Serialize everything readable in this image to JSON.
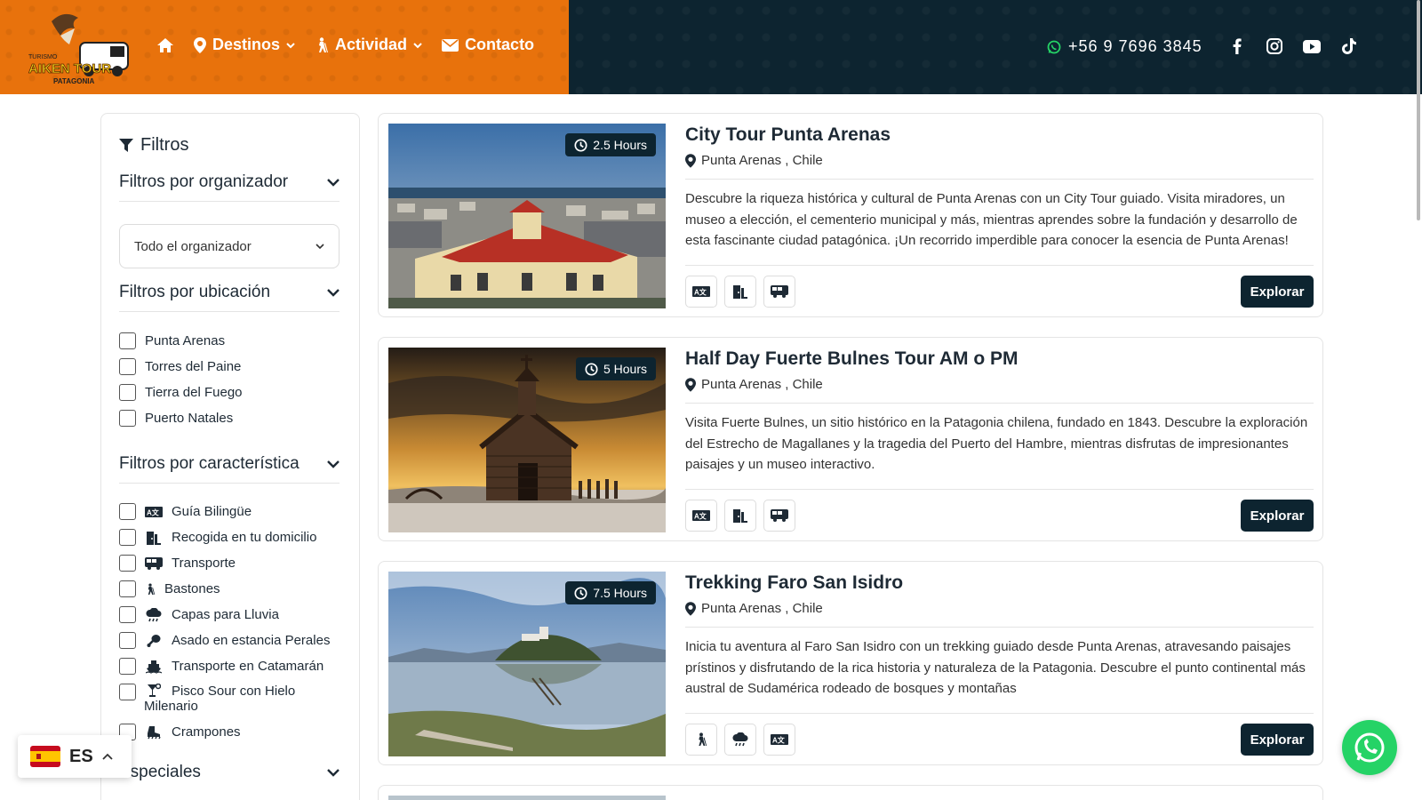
{
  "header": {
    "logo_text": [
      "TURISMO",
      "AIKEN TOUR",
      "PATAGONIA"
    ],
    "nav": [
      {
        "label": "Destinos",
        "icon": "map-pin-icon",
        "dropdown": true
      },
      {
        "label": "Actividad",
        "icon": "hiker-icon",
        "dropdown": true
      },
      {
        "label": "Contacto",
        "icon": "envelope-icon",
        "dropdown": false
      }
    ],
    "phone": "+56 9 7696 3845",
    "socials": [
      "facebook-icon",
      "instagram-icon",
      "youtube-icon",
      "tiktok-icon"
    ],
    "colors": {
      "orange": "#e8720c",
      "navy": "#0d2430"
    }
  },
  "sidebar": {
    "title": "Filtros",
    "organizer_section": "Filtros por organizador",
    "organizer_select": "Todo el organizador",
    "location_section": "Filtros por ubicación",
    "locations": [
      "Punta Arenas",
      "Torres del Paine",
      "Tierra del Fuego",
      "Puerto Natales"
    ],
    "feature_section": "Filtros por característica",
    "features": [
      {
        "label": "Guía Bilingüe",
        "icon": "translate-icon"
      },
      {
        "label": "Recogida en tu domicilio",
        "icon": "door-icon"
      },
      {
        "label": "Transporte",
        "icon": "bus-icon"
      },
      {
        "label": "Bastones",
        "icon": "hiker-icon"
      },
      {
        "label": "Capas para Lluvia",
        "icon": "rain-cloud-icon"
      },
      {
        "label": "Asado en estancia Perales",
        "icon": "drumstick-icon"
      },
      {
        "label": "Transporte en Catamarán",
        "icon": "ship-icon"
      },
      {
        "label": "Pisco Sour con Hielo",
        "label2": "Milenario",
        "icon": "cocktail-icon"
      },
      {
        "label": "Crampones",
        "icon": "boot-icon"
      }
    ],
    "special_section": "Especiales"
  },
  "tours": [
    {
      "title": "City Tour Punta Arenas",
      "duration": "2.5 Hours",
      "location": "Punta Arenas , Chile",
      "description": "Descubre la riqueza histórica y cultural de Punta Arenas con un City Tour guiado. Visita miradores, un museo a elección, el cementerio municipal y más, mientras aprendes sobre la fundación y desarrollo de esta fascinante ciudad patagónica. ¡Un recorrido imperdible para conocer la esencia de Punta Arenas!",
      "features": [
        "translate-icon",
        "door-icon",
        "bus-icon"
      ],
      "button": "Explorar"
    },
    {
      "title": "Half Day Fuerte Bulnes Tour AM o PM",
      "duration": "5 Hours",
      "location": "Punta Arenas , Chile",
      "description": "Visita Fuerte Bulnes, un sitio histórico en la Patagonia chilena, fundado en 1843. Descubre la exploración del Estrecho de Magallanes y la tragedia del Puerto del Hambre, mientras disfrutas de impresionantes paisajes y un museo interactivo.",
      "features": [
        "translate-icon",
        "door-icon",
        "bus-icon"
      ],
      "button": "Explorar"
    },
    {
      "title": "Trekking Faro San Isidro",
      "duration": "7.5 Hours",
      "location": "Punta Arenas , Chile",
      "description": "Inicia tu aventura al Faro San Isidro con un trekking guiado desde Punta Arenas, atravesando paisajes prístinos y disfrutando de la rica historia y naturaleza de la Patagonia. Descubre el punto continental más austral de Sudamérica rodeado de bosques y montañas",
      "features": [
        "hiker-icon",
        "rain-cloud-icon",
        "translate-icon"
      ],
      "button": "Explorar"
    }
  ],
  "language": {
    "code": "ES",
    "flag": "spain-flag-icon"
  },
  "whatsapp": "whatsapp-icon"
}
